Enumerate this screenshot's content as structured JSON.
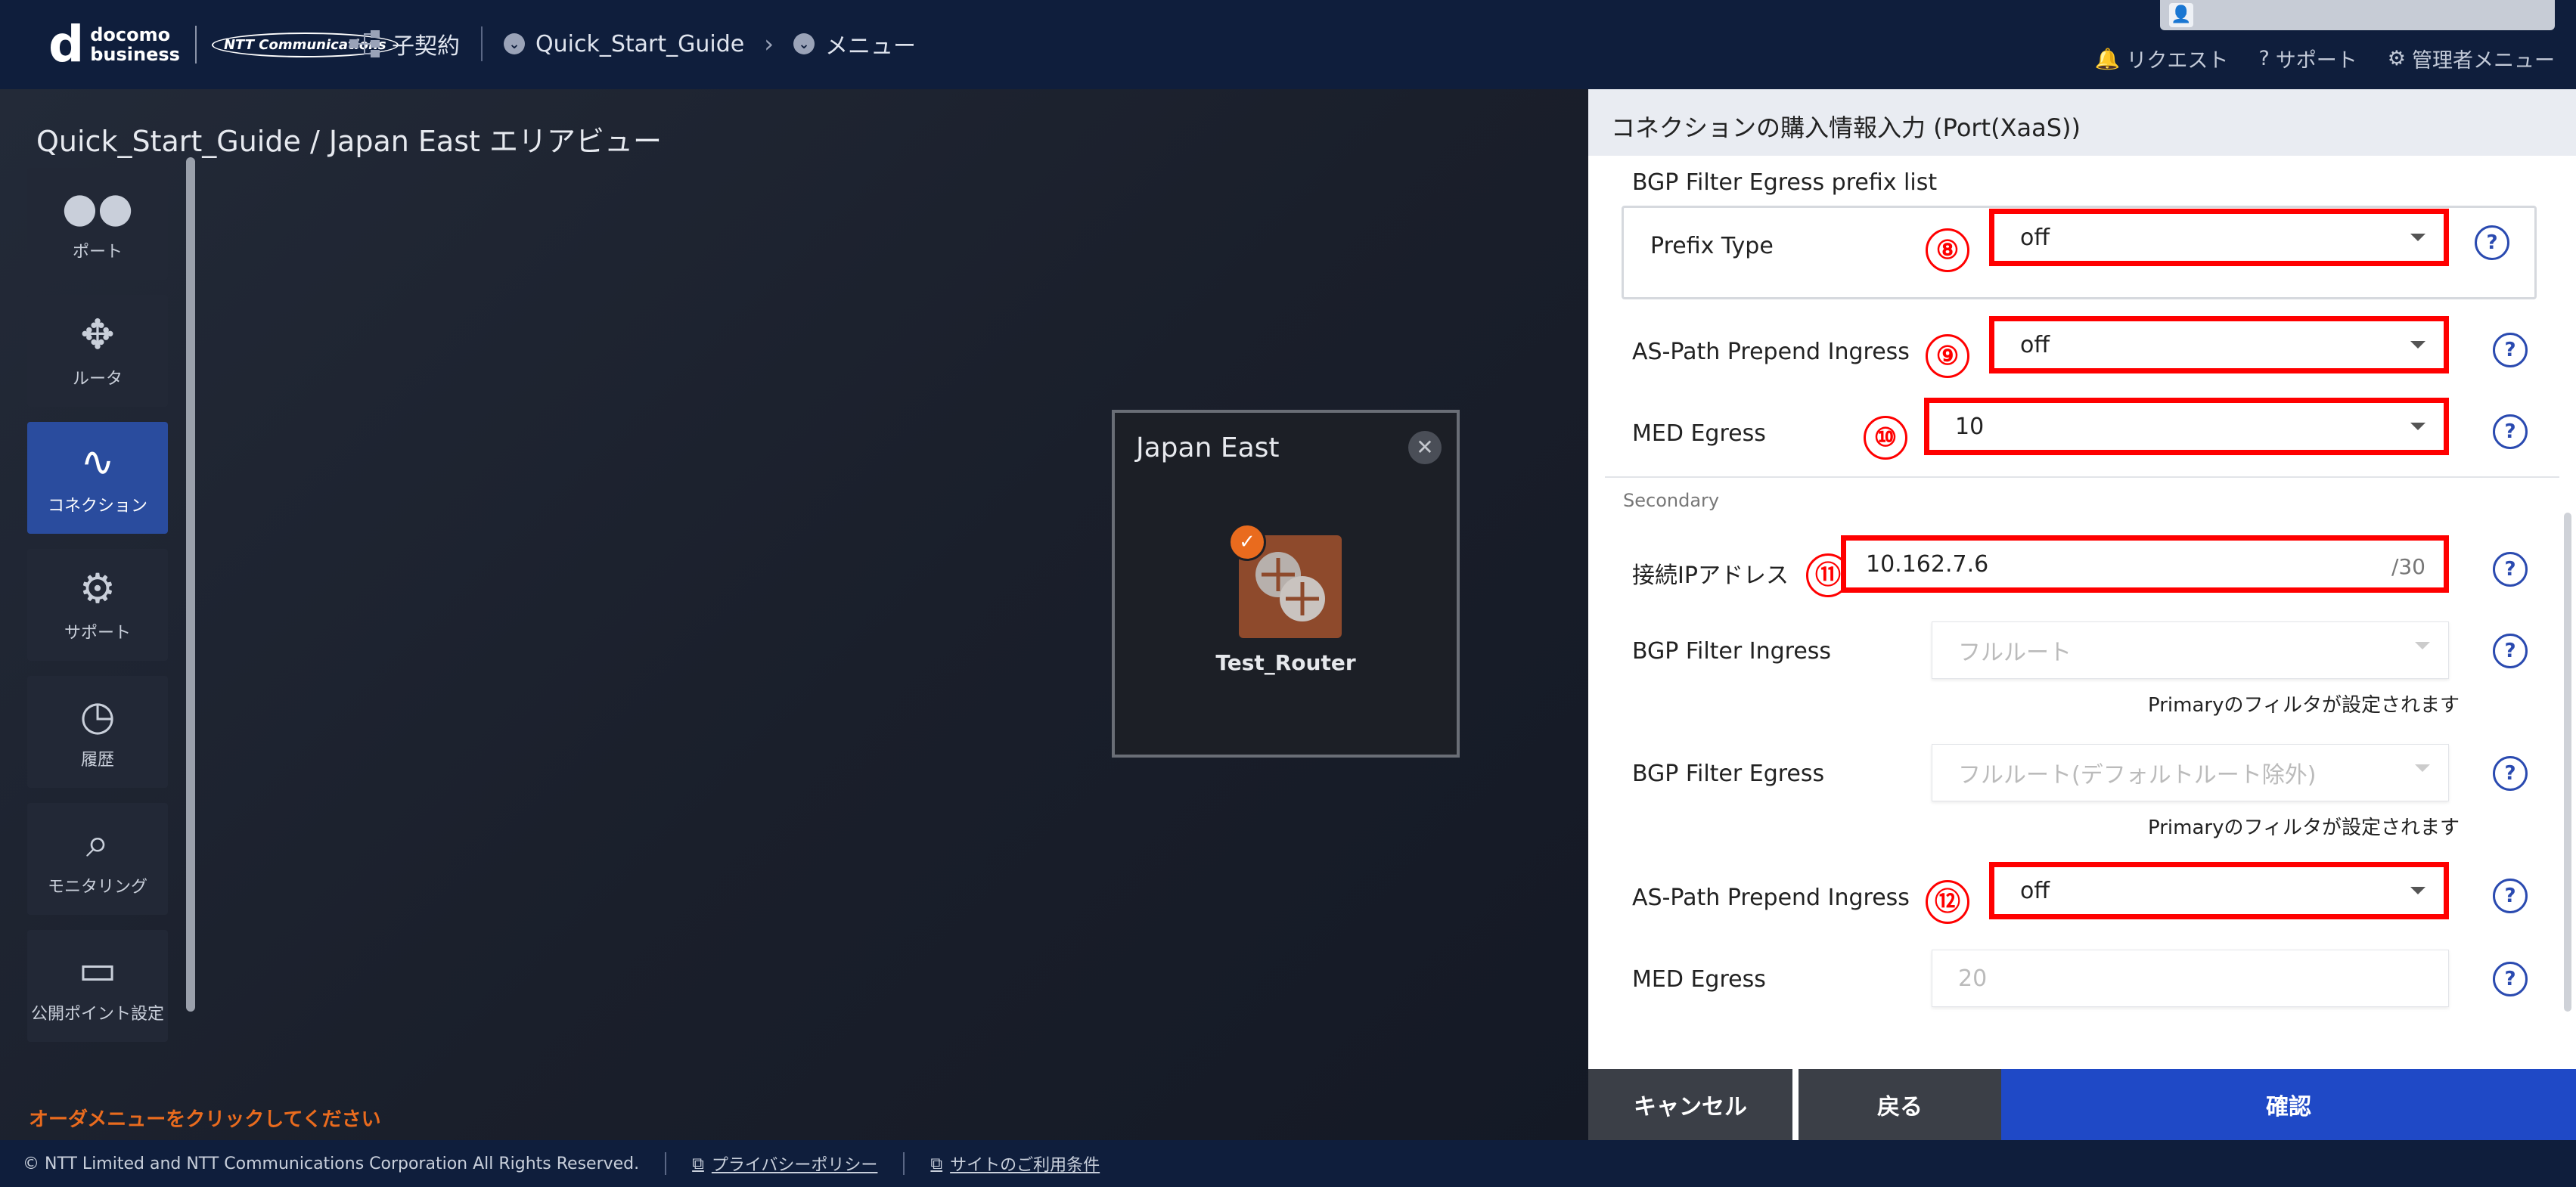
{
  "header": {
    "logo_main": "d",
    "logo_line1": "docomo",
    "logo_line2": "business",
    "logo_ntt": "NTT Communications",
    "nav_contract": "子契約",
    "nav_guide": "Quick_Start_Guide",
    "nav_menu": "メニュー",
    "link_request": "リクエスト",
    "link_support": "サポート",
    "link_admin": "管理者メニュー"
  },
  "breadcrumb": "Quick_Start_Guide / Japan East エリアビュー",
  "sidebar": {
    "items": [
      {
        "label": "ポート"
      },
      {
        "label": "ルータ"
      },
      {
        "label": "コネクション"
      },
      {
        "label": "サポート"
      },
      {
        "label": "履歴"
      },
      {
        "label": "モニタリング"
      },
      {
        "label": "公開ポイント設定"
      }
    ]
  },
  "order_hint": "オーダメニューをクリックしてください",
  "area_card": {
    "title": "Japan East",
    "router_name": "Test_Router"
  },
  "panel": {
    "title": "コネクションの購入情報入力 (Port(XaaS))",
    "bgp_egress_prefix_title": "BGP Filter Egress prefix list",
    "prefix_type_label": "Prefix Type",
    "prefix_type_value": "off",
    "as_path_ingress_label": "AS-Path Prepend Ingress",
    "as_path_ingress_value": "off",
    "med_egress_label": "MED Egress",
    "med_egress_value": "10",
    "secondary_label": "Secondary",
    "ip_label": "接続IPアドレス",
    "ip_value": "10.162.7.6",
    "ip_suffix": "/30",
    "bgp_ingress_label": "BGP Filter Ingress",
    "bgp_ingress_value": "フルルート",
    "bgp_ingress_note": "Primaryのフィルタが設定されます",
    "bgp_egress_label": "BGP Filter Egress",
    "bgp_egress_value": "フルルート(デフォルトルート除外)",
    "bgp_egress_note": "Primaryのフィルタが設定されます",
    "as_path_ingress2_label": "AS-Path Prepend Ingress",
    "as_path_ingress2_value": "off",
    "med_egress2_label": "MED Egress",
    "med_egress2_value": "20",
    "markers": [
      "⑧",
      "⑨",
      "⑩",
      "⑪",
      "⑫"
    ]
  },
  "buttons": {
    "cancel": "キャンセル",
    "back": "戻る",
    "confirm": "確認"
  },
  "footer": {
    "copyright": "© NTT Limited and NTT Communications Corporation All Rights Reserved.",
    "privacy": "プライバシーポリシー",
    "terms": "サイトのご利用条件"
  },
  "colors": {
    "header_bg": "#0f1e3c",
    "active_nav": "#2a4c9e",
    "confirm_button": "#1f49c6",
    "highlight": "#ff0000",
    "accent_orange": "#e96b1e"
  }
}
